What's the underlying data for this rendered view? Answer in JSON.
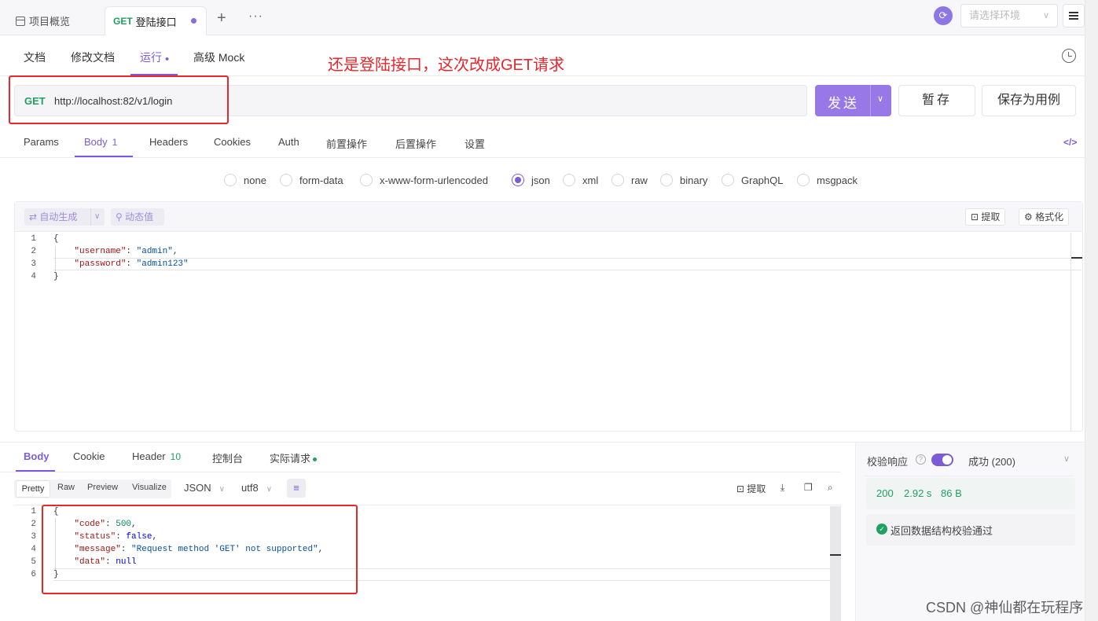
{
  "top_tabs": {
    "overview": "项目概览",
    "active_method": "GET",
    "active_name": "登陆接口",
    "add": "+",
    "more": "···"
  },
  "environment": {
    "placeholder": "请选择环境"
  },
  "sub_tabs": [
    "文档",
    "修改文档",
    "运行",
    "高级 Mock"
  ],
  "annotation_top": "还是登陆接口，这次改成GET请求",
  "request": {
    "method": "GET",
    "url": "http://localhost:82/v1/login",
    "send": "发送",
    "stash": "暂存",
    "save_case": "保存为用例"
  },
  "request_tabs": [
    "Params",
    "Body",
    "Headers",
    "Cookies",
    "Auth",
    "前置操作",
    "后置操作",
    "设置"
  ],
  "request_body_count": "1",
  "body_types": [
    "none",
    "form-data",
    "x-www-form-urlencoded",
    "json",
    "xml",
    "raw",
    "binary",
    "GraphQL",
    "msgpack"
  ],
  "body_type_selected": "json",
  "request_toolbar": {
    "auto_generate": "自动生成",
    "dynamic_value": "动态值",
    "extract": "提取",
    "format": "格式化"
  },
  "request_body_lines": [
    "1",
    "2",
    "3",
    "4"
  ],
  "request_body": {
    "username_key": "\"username\"",
    "username_val": "\"admin\"",
    "password_key": "\"password\"",
    "password_val": "\"admin123\""
  },
  "response_tabs": {
    "body": "Body",
    "cookie": "Cookie",
    "header": "Header",
    "header_count": "10",
    "console": "控制台",
    "real_request": "实际请求"
  },
  "response_view": [
    "Pretty",
    "Raw",
    "Preview",
    "Visualize"
  ],
  "response_format": "JSON",
  "response_encoding": "utf8",
  "response_extract": "提取",
  "response_body_lines": [
    "1",
    "2",
    "3",
    "4",
    "5",
    "6"
  ],
  "response_body": {
    "code_key": "\"code\"",
    "code_val": "500",
    "status_key": "\"status\"",
    "status_val": "false",
    "message_key": "\"message\"",
    "message_val": "\"Request method 'GET' not supported\"",
    "data_key": "\"data\"",
    "data_val": "null"
  },
  "validation": {
    "label": "校验响应",
    "status": "成功 (200)",
    "status_code": "200",
    "time": "2.92 s",
    "size": "86 B",
    "schema_result": "返回数据结构校验通过"
  },
  "watermark": "CSDN @神仙都在玩程序",
  "colors": {
    "accent": "#7b5cd6",
    "get": "#20a162",
    "annotation": "#e8262b"
  }
}
